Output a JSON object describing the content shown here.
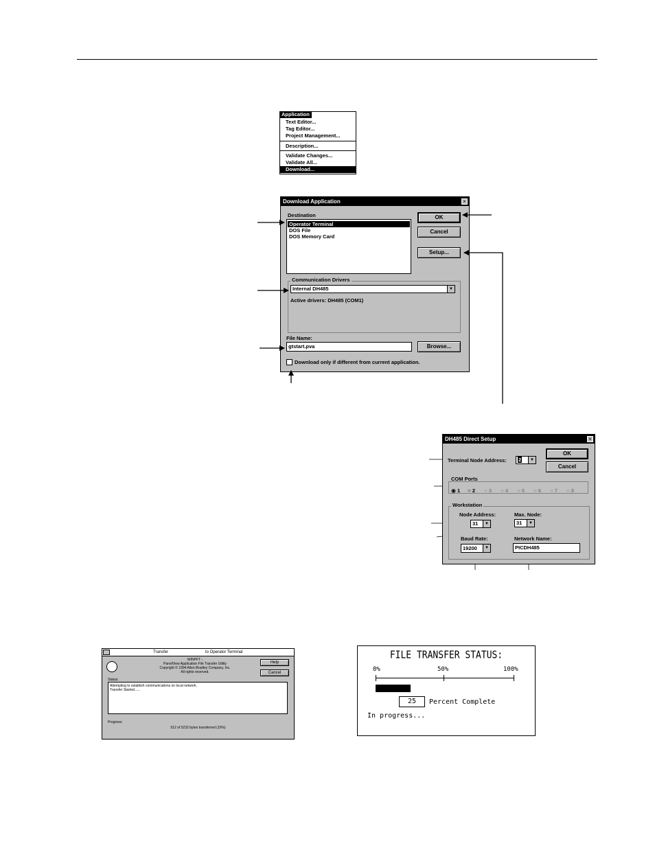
{
  "menu": {
    "title": "Application",
    "items": [
      "Text Editor...",
      "Tag Editor...",
      "Project Management...",
      "Description...",
      "Validate Changes...",
      "Validate All...",
      "Download..."
    ]
  },
  "download_dialog": {
    "title": "Download Application",
    "destination_label": "Destination",
    "destinations": [
      "Operator Terminal",
      "DOS File",
      "DOS Memory Card"
    ],
    "ok": "OK",
    "cancel": "Cancel",
    "setup": "Setup...",
    "comm_drivers_label": "Communication Drivers",
    "driver_value": "Internal DH485",
    "active_drivers": "Active drivers: DH485 (COM1)",
    "file_name_label": "File Name:",
    "file_name_value": "gtstart.pva",
    "browse": "Browse...",
    "checkbox_label": "Download only if different from current application."
  },
  "dh485_dialog": {
    "title": "DH485 Direct Setup",
    "terminal_node_label": "Terminal Node Address:",
    "terminal_node_value": "2",
    "ok": "OK",
    "cancel": "Cancel",
    "com_ports_label": "COM Ports",
    "com_ports": [
      "1",
      "2",
      "3",
      "4",
      "5",
      "6",
      "7",
      "8"
    ],
    "workstation_label": "Workstation",
    "node_address_label": "Node Address:",
    "node_address_value": "31",
    "max_node_label": "Max. Node:",
    "max_node_value": "31",
    "baud_rate_label": "Baud Rate:",
    "baud_rate_value": "19200",
    "network_name_label": "Network Name:",
    "network_name_value": "PICDH485"
  },
  "transfer_dialog": {
    "title_left": "Transfer",
    "title_right": "to Operator Terminal",
    "app_name": "WINPFT -",
    "subtitle": "PanelView Application File Transfer Utility",
    "copyright": "Copyright © 1994 Allen-Bradley Company, Inc.",
    "rights": "All rights reserved.",
    "help": "Help",
    "cancel": "Cancel",
    "status_label": "Status:",
    "status_lines": [
      "Attempting to establish communications on local network.",
      "Transfer Started......"
    ],
    "progress_label": "Progress:",
    "progress_text": "512 of 5232 bytes transferred (10%)"
  },
  "file_status": {
    "title": "FILE TRANSFER STATUS:",
    "scale": [
      "0%",
      "50%",
      "100%"
    ],
    "percent": 25,
    "percent_text": "25",
    "percent_label": "Percent Complete",
    "in_progress": "In progress..."
  }
}
